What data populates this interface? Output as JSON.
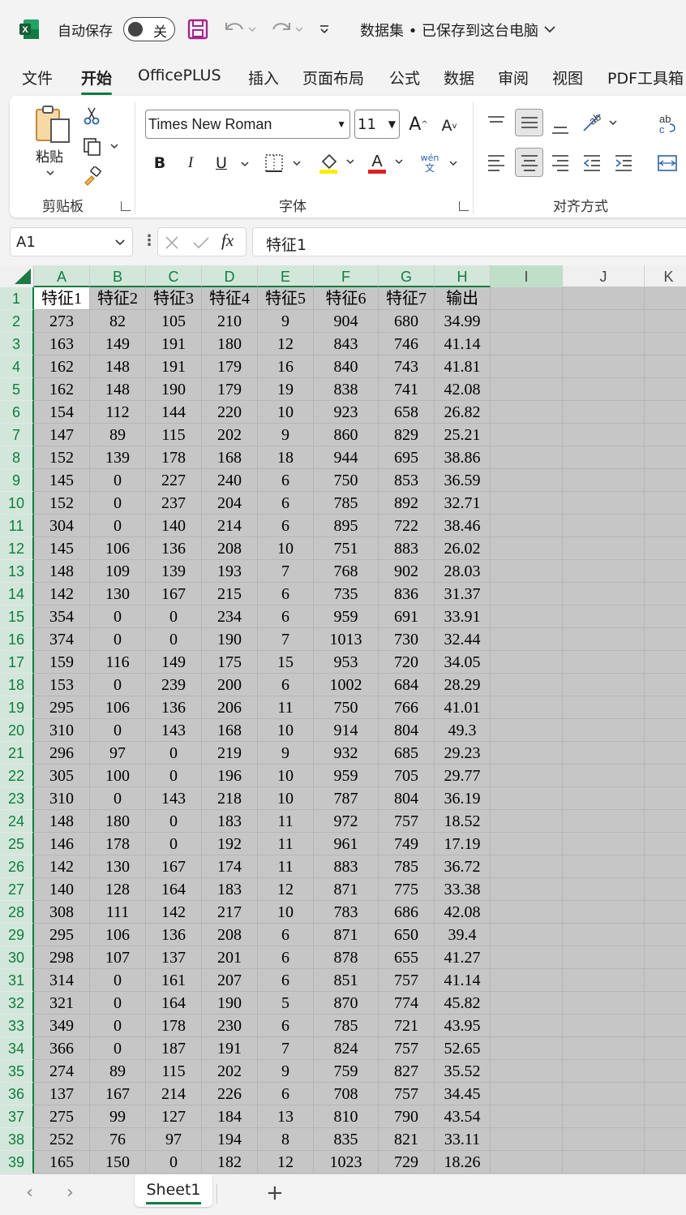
{
  "titlebar": {
    "autosave_label": "自动保存",
    "autosave_state": "关",
    "doc_title": "数据集 • 已保存到这台电脑"
  },
  "tabs": [
    "文件",
    "开始",
    "OfficePLUS",
    "插入",
    "页面布局",
    "公式",
    "数据",
    "审阅",
    "视图",
    "PDF工具箱"
  ],
  "active_tab": "开始",
  "ribbon": {
    "paste_label": "粘贴",
    "clipboard_group": "剪贴板",
    "font_name": "Times New Roman",
    "font_size": "11",
    "font_group": "字体",
    "align_group": "对齐方式",
    "bold": "B",
    "italic": "I",
    "underline": "U",
    "font_color_glyph": "A",
    "phonetic_top": "wén",
    "phonetic_bottom": "文",
    "wrap_glyph": "ab",
    "grow_font": "A",
    "shrink_font": "A",
    "colors": {
      "accent": "#107c41",
      "highlight": "#ffee00",
      "font_red": "#e02020"
    }
  },
  "formula_bar": {
    "name_box": "A1",
    "fx": "fx",
    "content": "特征1"
  },
  "columns": [
    "A",
    "B",
    "C",
    "D",
    "E",
    "F",
    "G",
    "H",
    "I",
    "J",
    "K"
  ],
  "rows": [
    [
      "特征1",
      "特征2",
      "特征3",
      "特征4",
      "特征5",
      "特征6",
      "特征7",
      "输出"
    ],
    [
      "273",
      "82",
      "105",
      "210",
      "9",
      "904",
      "680",
      "34.99"
    ],
    [
      "163",
      "149",
      "191",
      "180",
      "12",
      "843",
      "746",
      "41.14"
    ],
    [
      "162",
      "148",
      "191",
      "179",
      "16",
      "840",
      "743",
      "41.81"
    ],
    [
      "162",
      "148",
      "190",
      "179",
      "19",
      "838",
      "741",
      "42.08"
    ],
    [
      "154",
      "112",
      "144",
      "220",
      "10",
      "923",
      "658",
      "26.82"
    ],
    [
      "147",
      "89",
      "115",
      "202",
      "9",
      "860",
      "829",
      "25.21"
    ],
    [
      "152",
      "139",
      "178",
      "168",
      "18",
      "944",
      "695",
      "38.86"
    ],
    [
      "145",
      "0",
      "227",
      "240",
      "6",
      "750",
      "853",
      "36.59"
    ],
    [
      "152",
      "0",
      "237",
      "204",
      "6",
      "785",
      "892",
      "32.71"
    ],
    [
      "304",
      "0",
      "140",
      "214",
      "6",
      "895",
      "722",
      "38.46"
    ],
    [
      "145",
      "106",
      "136",
      "208",
      "10",
      "751",
      "883",
      "26.02"
    ],
    [
      "148",
      "109",
      "139",
      "193",
      "7",
      "768",
      "902",
      "28.03"
    ],
    [
      "142",
      "130",
      "167",
      "215",
      "6",
      "735",
      "836",
      "31.37"
    ],
    [
      "354",
      "0",
      "0",
      "234",
      "6",
      "959",
      "691",
      "33.91"
    ],
    [
      "374",
      "0",
      "0",
      "190",
      "7",
      "1013",
      "730",
      "32.44"
    ],
    [
      "159",
      "116",
      "149",
      "175",
      "15",
      "953",
      "720",
      "34.05"
    ],
    [
      "153",
      "0",
      "239",
      "200",
      "6",
      "1002",
      "684",
      "28.29"
    ],
    [
      "295",
      "106",
      "136",
      "206",
      "11",
      "750",
      "766",
      "41.01"
    ],
    [
      "310",
      "0",
      "143",
      "168",
      "10",
      "914",
      "804",
      "49.3"
    ],
    [
      "296",
      "97",
      "0",
      "219",
      "9",
      "932",
      "685",
      "29.23"
    ],
    [
      "305",
      "100",
      "0",
      "196",
      "10",
      "959",
      "705",
      "29.77"
    ],
    [
      "310",
      "0",
      "143",
      "218",
      "10",
      "787",
      "804",
      "36.19"
    ],
    [
      "148",
      "180",
      "0",
      "183",
      "11",
      "972",
      "757",
      "18.52"
    ],
    [
      "146",
      "178",
      "0",
      "192",
      "11",
      "961",
      "749",
      "17.19"
    ],
    [
      "142",
      "130",
      "167",
      "174",
      "11",
      "883",
      "785",
      "36.72"
    ],
    [
      "140",
      "128",
      "164",
      "183",
      "12",
      "871",
      "775",
      "33.38"
    ],
    [
      "308",
      "111",
      "142",
      "217",
      "10",
      "783",
      "686",
      "42.08"
    ],
    [
      "295",
      "106",
      "136",
      "208",
      "6",
      "871",
      "650",
      "39.4"
    ],
    [
      "298",
      "107",
      "137",
      "201",
      "6",
      "878",
      "655",
      "41.27"
    ],
    [
      "314",
      "0",
      "161",
      "207",
      "6",
      "851",
      "757",
      "41.14"
    ],
    [
      "321",
      "0",
      "164",
      "190",
      "5",
      "870",
      "774",
      "45.82"
    ],
    [
      "349",
      "0",
      "178",
      "230",
      "6",
      "785",
      "721",
      "43.95"
    ],
    [
      "366",
      "0",
      "187",
      "191",
      "7",
      "824",
      "757",
      "52.65"
    ],
    [
      "274",
      "89",
      "115",
      "202",
      "9",
      "759",
      "827",
      "35.52"
    ],
    [
      "137",
      "167",
      "214",
      "226",
      "6",
      "708",
      "757",
      "34.45"
    ],
    [
      "275",
      "99",
      "127",
      "184",
      "13",
      "810",
      "790",
      "43.54"
    ],
    [
      "252",
      "76",
      "97",
      "194",
      "8",
      "835",
      "821",
      "33.11"
    ],
    [
      "165",
      "150",
      "0",
      "182",
      "12",
      "1023",
      "729",
      "18.26"
    ]
  ],
  "sheet_tabs": [
    "Sheet1"
  ],
  "add_sheet": "+"
}
